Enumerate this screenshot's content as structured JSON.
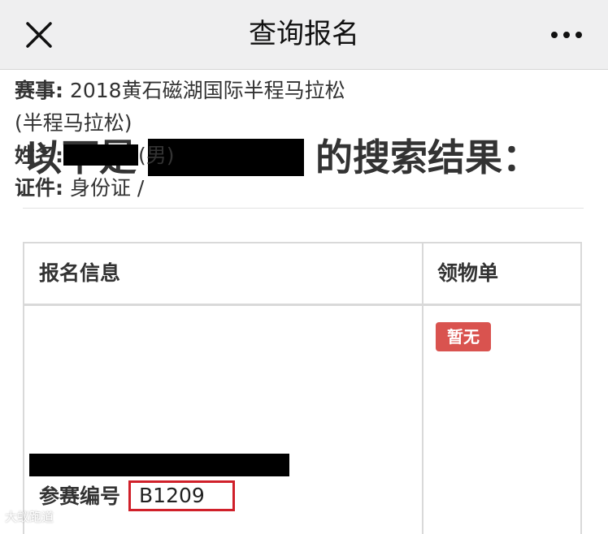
{
  "header": {
    "title": "查询报名",
    "close_icon": "close-icon",
    "more_icon": "more-dots-icon"
  },
  "result": {
    "prefix": "以下是",
    "suffix": "的搜索结果："
  },
  "table": {
    "columns": [
      "报名信息",
      "领物单"
    ],
    "row": {
      "event_label": "赛事:",
      "event_value": "2018黄石磁湖国际半程马拉松",
      "event_value_line2": "(半程马拉松)",
      "name_label": "姓名:",
      "name_suffix": "(男)",
      "id_label": "证件:",
      "id_value": "身份证 /",
      "bib_label": "参赛编号",
      "bib_value": "B1209",
      "status_badge": "暂无"
    }
  },
  "colors": {
    "topbar": "#efeff0",
    "badge": "#d9534f",
    "highlight_box": "#d0202a"
  },
  "watermark": "大蚁跑道"
}
